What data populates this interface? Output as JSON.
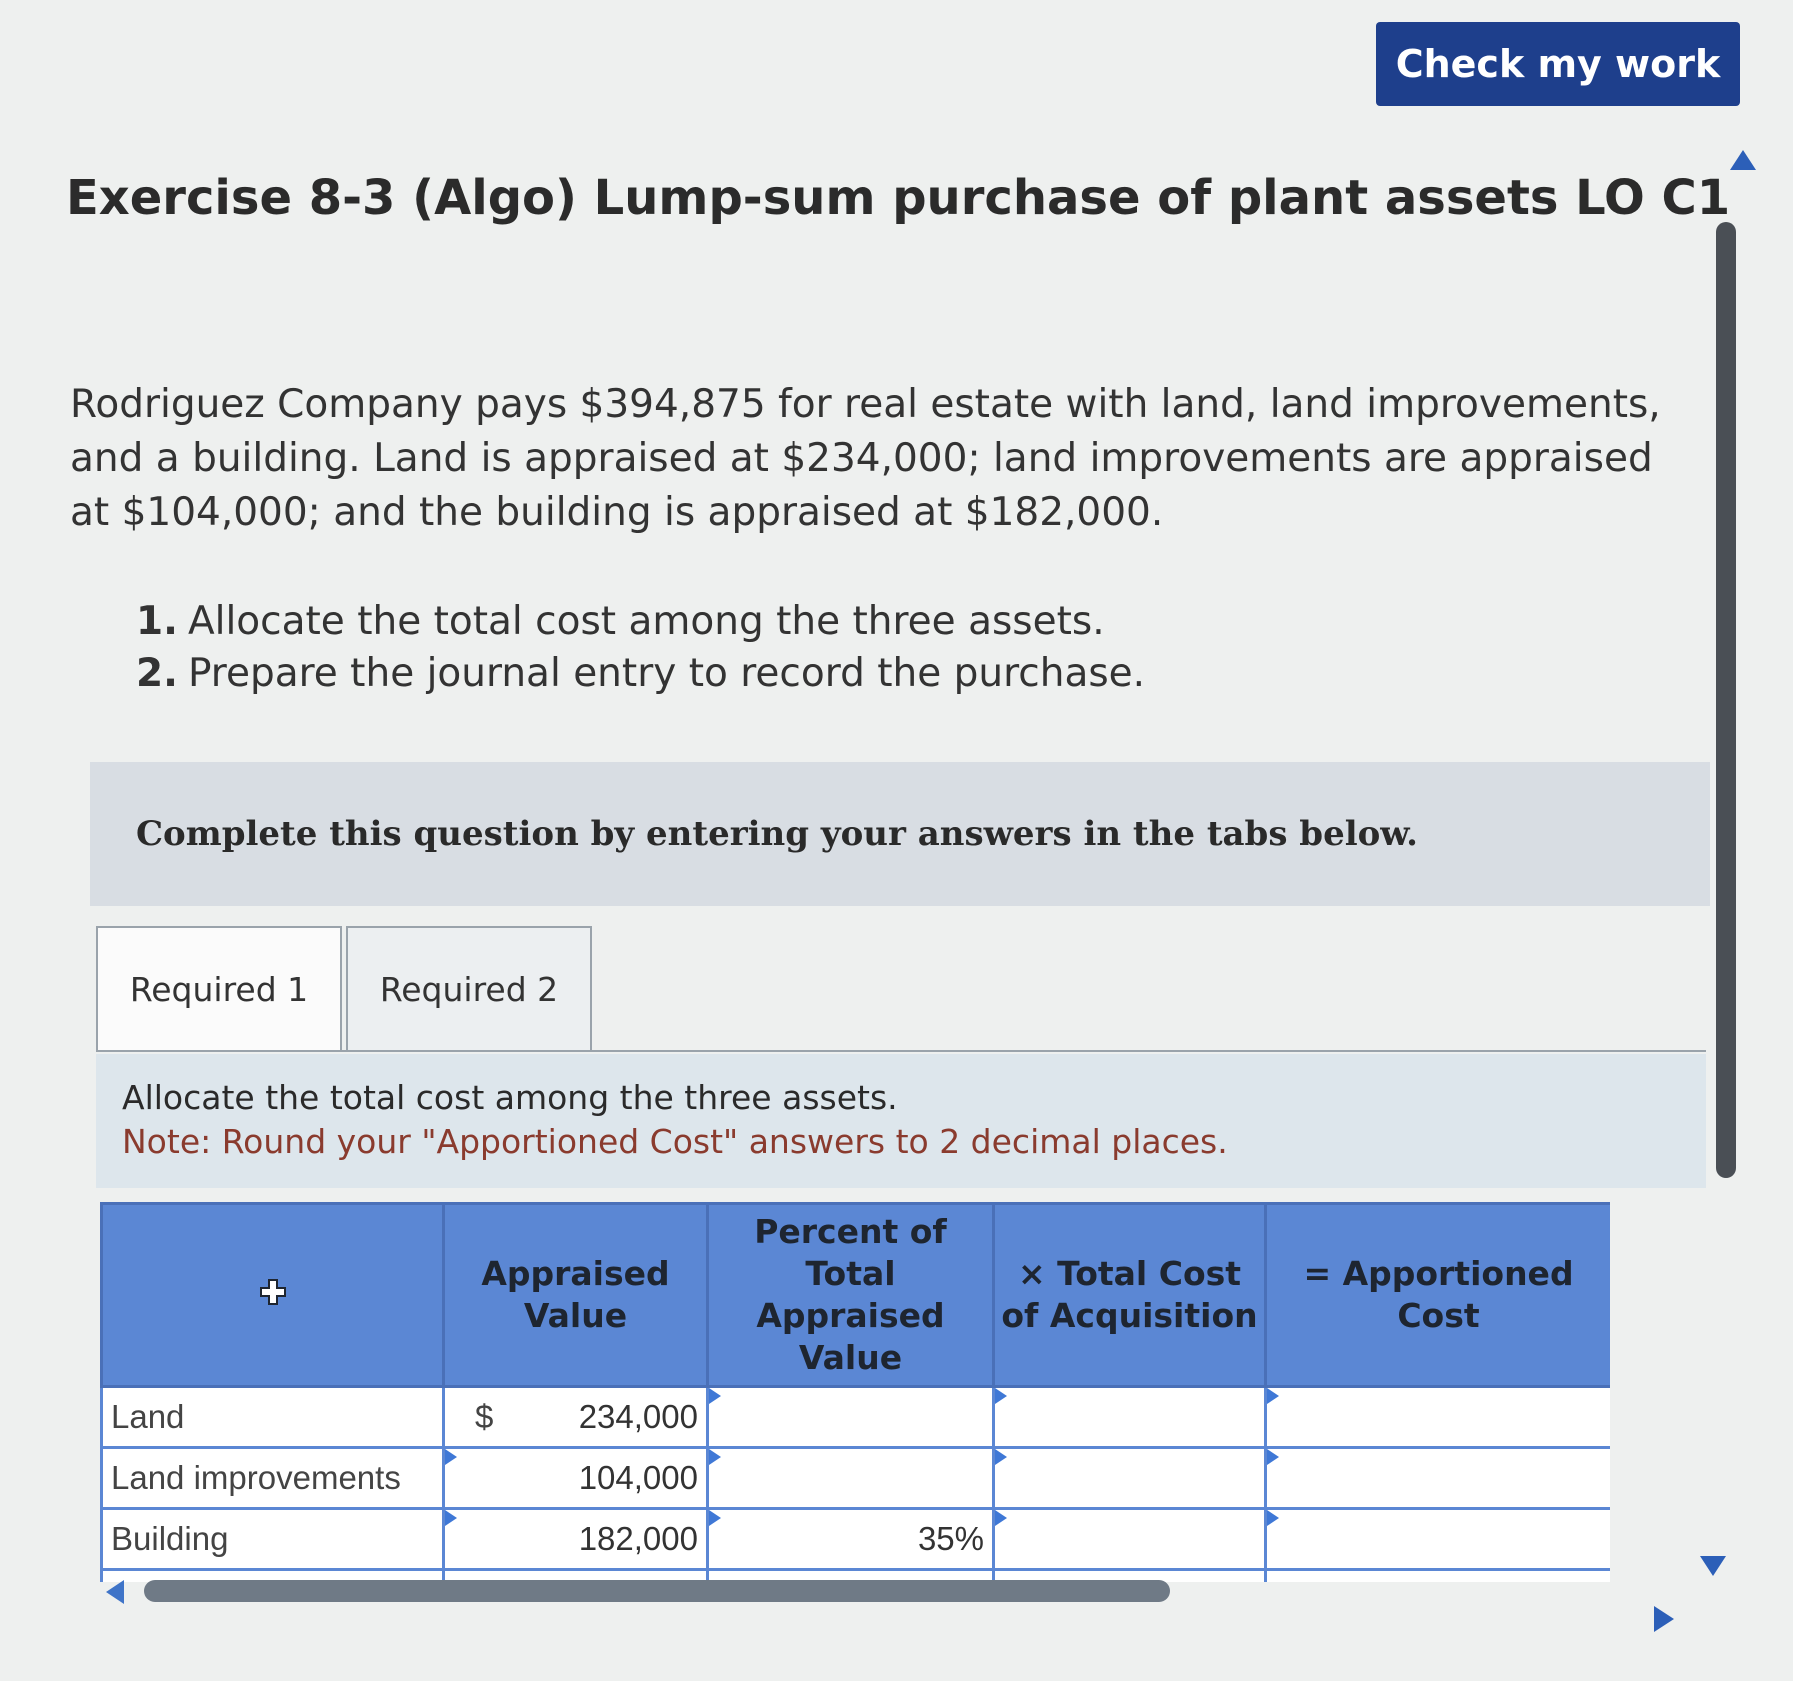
{
  "header": {
    "check_label": "Check my work"
  },
  "title": "Exercise 8-3 (Algo) Lump-sum purchase of plant assets LO C1",
  "problem_text": "Rodriguez Company pays $394,875 for real estate with land, land improvements, and a building. Land is appraised at $234,000; land improvements are appraised at $104,000; and the building is appraised at $182,000.",
  "steps": [
    {
      "num": "1.",
      "text": "Allocate the total cost among the three assets."
    },
    {
      "num": "2.",
      "text": "Prepare the journal entry to record the purchase."
    }
  ],
  "instruction_banner": "Complete this question by entering your answers in the tabs below.",
  "tabs": [
    {
      "label": "Required 1"
    },
    {
      "label": "Required 2"
    }
  ],
  "section": {
    "instruction": "Allocate the total cost among the three assets.",
    "note": "Note: Round your \"Apportioned Cost\" answers to 2 decimal places."
  },
  "table": {
    "headers": [
      "",
      "Appraised Value",
      "Percent of Total Appraised Value",
      "× Total Cost of Acquisition",
      "= Apportioned Cost"
    ],
    "currency_symbol": "$",
    "rows": [
      {
        "label": "Land",
        "appraised": "234,000",
        "percent": "",
        "total_cost": "",
        "apportioned": ""
      },
      {
        "label": "Land improvements",
        "appraised": "104,000",
        "percent": "",
        "total_cost": "",
        "apportioned": ""
      },
      {
        "label": "Building",
        "appraised": "182,000",
        "percent": "35%",
        "total_cost": "",
        "apportioned": ""
      }
    ]
  },
  "icons": {
    "add": "plus-icon",
    "scroll": "scrollbar-arrows"
  },
  "colors": {
    "button": "#1e3f8c",
    "header": "#5b87d4",
    "border": "#4a70b8",
    "note": "#8a3b2e"
  }
}
